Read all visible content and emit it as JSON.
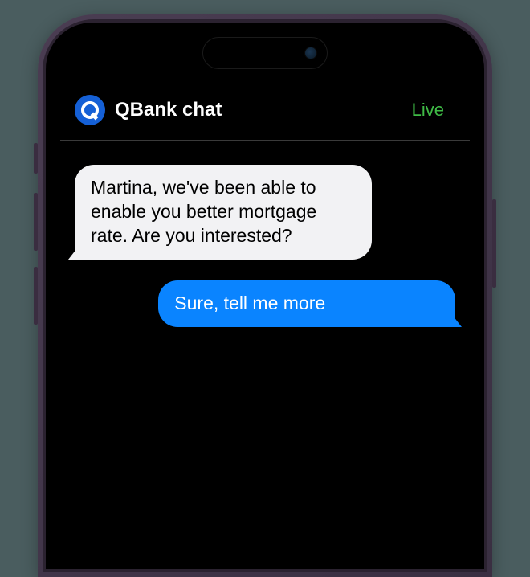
{
  "header": {
    "app_title": "QBank chat",
    "status": "Live",
    "logo_name": "qbank-logo"
  },
  "messages": [
    {
      "direction": "incoming",
      "text": "Martina, we've been able to enable you better mortgage rate. Are you interested?"
    },
    {
      "direction": "outgoing",
      "text": "Sure, tell me more"
    }
  ],
  "colors": {
    "status": "#3fbb46",
    "outgoing_bubble": "#0a84ff",
    "incoming_bubble": "#f2f2f4",
    "logo_bg": "#1560d6"
  }
}
